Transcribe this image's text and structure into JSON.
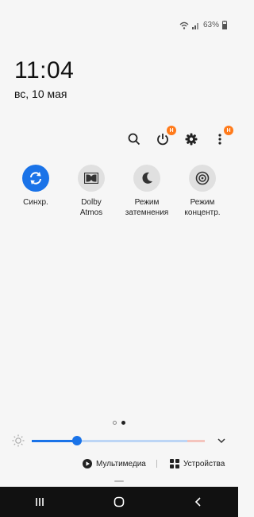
{
  "status": {
    "battery": "63%"
  },
  "clock": {
    "time": "11:04",
    "date": "вс, 10 мая"
  },
  "toolbar": {
    "power_badge": "Н",
    "more_badge": "Н"
  },
  "tiles": [
    {
      "label": "Синхр.",
      "icon": "sync-icon",
      "active": true
    },
    {
      "label": "Dolby\nAtmos",
      "icon": "dolby-icon",
      "active": false
    },
    {
      "label": "Режим\nзатемнения",
      "icon": "moon-icon",
      "active": false
    },
    {
      "label": "Режим\nконцентр.",
      "icon": "focus-icon",
      "active": false
    }
  ],
  "brightness": {
    "level": 0.26
  },
  "media": {
    "multimedia": "Мультимедиа",
    "devices": "Устройства"
  },
  "colors": {
    "accent": "#1a73e8",
    "badge": "#ff7a1a"
  }
}
